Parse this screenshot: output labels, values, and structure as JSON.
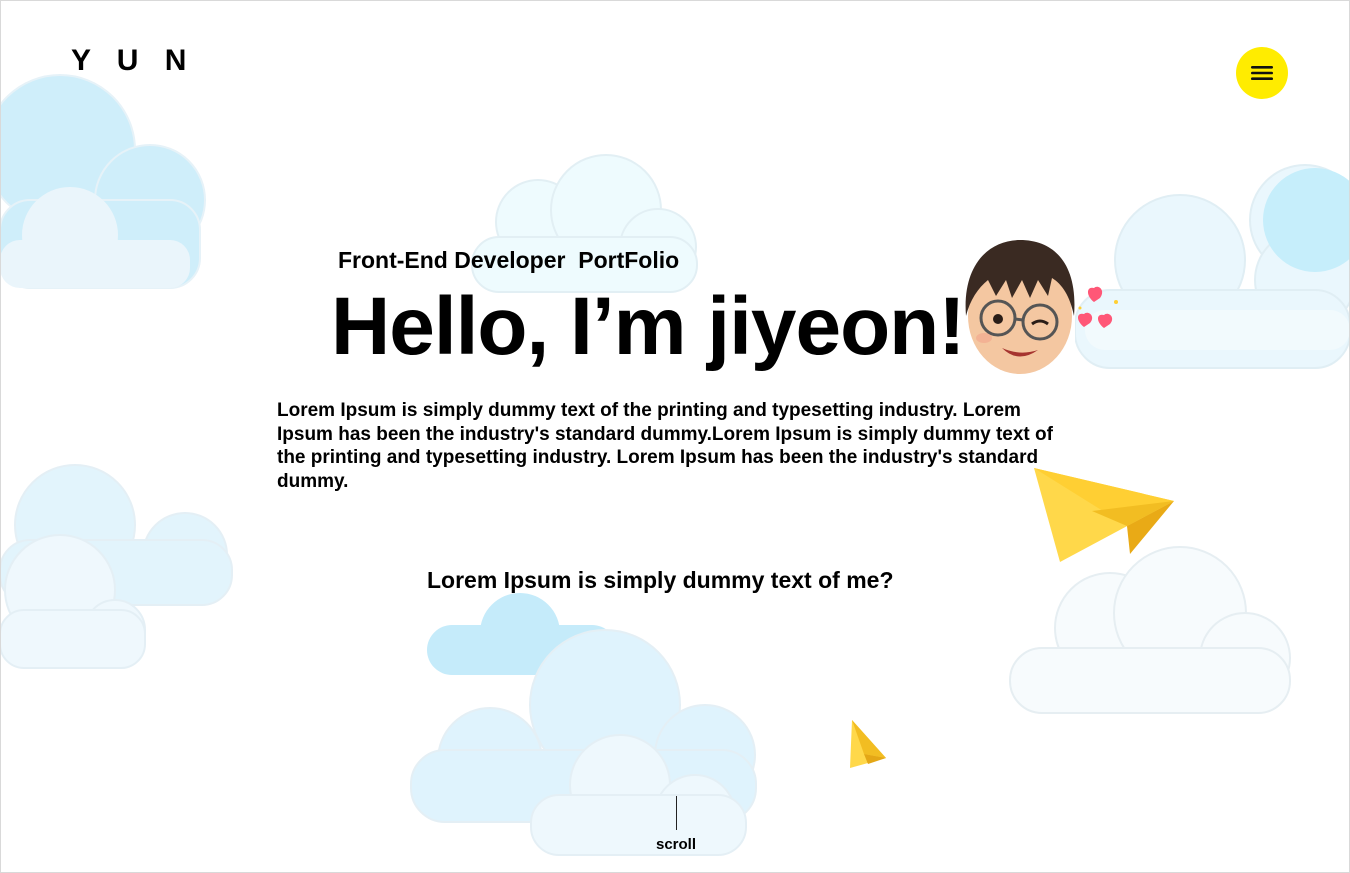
{
  "header": {
    "logo": "Y U N",
    "menu_icon": "hamburger-menu-icon"
  },
  "hero": {
    "subtitle": "Front-End Developer  PortFolio",
    "headline": "Hello, I’m jiyeon!",
    "intro": "Lorem Ipsum is simply dummy text of the printing and typesetting industry. Lorem Ipsum has been the industry's standard dummy.Lorem Ipsum is simply dummy text of the printing and typesetting industry. Lorem Ipsum has been the industry's standard dummy.",
    "question": "Lorem Ipsum is simply dummy text of me?"
  },
  "scroll": {
    "label": "scroll"
  },
  "colors": {
    "accent": "#ffec00",
    "cloud": "#cfeefc",
    "plane": "#fcd535"
  }
}
